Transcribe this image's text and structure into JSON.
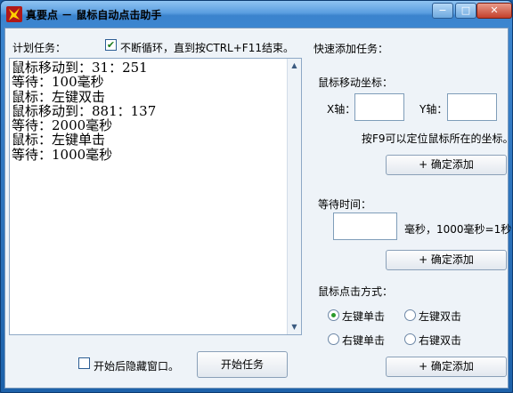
{
  "window": {
    "title": "真要点 － 鼠标自动点击助手",
    "minimize_glyph": "−",
    "maximize_glyph": "□",
    "close_glyph": "✕"
  },
  "task_list": {
    "label": "计划任务：",
    "lines": [
      "鼠标移动到：31：251",
      "等待：100毫秒",
      "鼠标：左键双击",
      "鼠标移动到：881：137",
      "等待：2000毫秒",
      "鼠标：左键单击",
      "等待：1000毫秒"
    ]
  },
  "loop": {
    "label": "不断循环，直到按CTRL+F11结束。",
    "checked": true
  },
  "hide_window": {
    "label": "开始后隐藏窗口。",
    "checked": false
  },
  "start_button": "开始任务",
  "quick_add": {
    "label": "快速添加任务：",
    "move": {
      "label": "鼠标移动坐标：",
      "x_label": "X轴：",
      "y_label": "Y轴：",
      "x_value": "",
      "y_value": "",
      "hint": "按F9可以定位鼠标所在的坐标。",
      "add_button": "+ 确定添加"
    },
    "wait": {
      "label": "等待时间：",
      "value": "",
      "hint": "毫秒，1000毫秒=1秒",
      "add_button": "+ 确定添加"
    },
    "click": {
      "label": "鼠标点击方式：",
      "options": [
        "左键单击",
        "左键双击",
        "右键单击",
        "右键双击"
      ],
      "selected": "左键单击",
      "add_button": "+ 确定添加"
    }
  },
  "colors": {
    "title_bar": "#4a90d9",
    "client_bg": "#eef3f8",
    "check_mark": "#1a7a1a",
    "radio_dot": "#2a9a2a"
  }
}
